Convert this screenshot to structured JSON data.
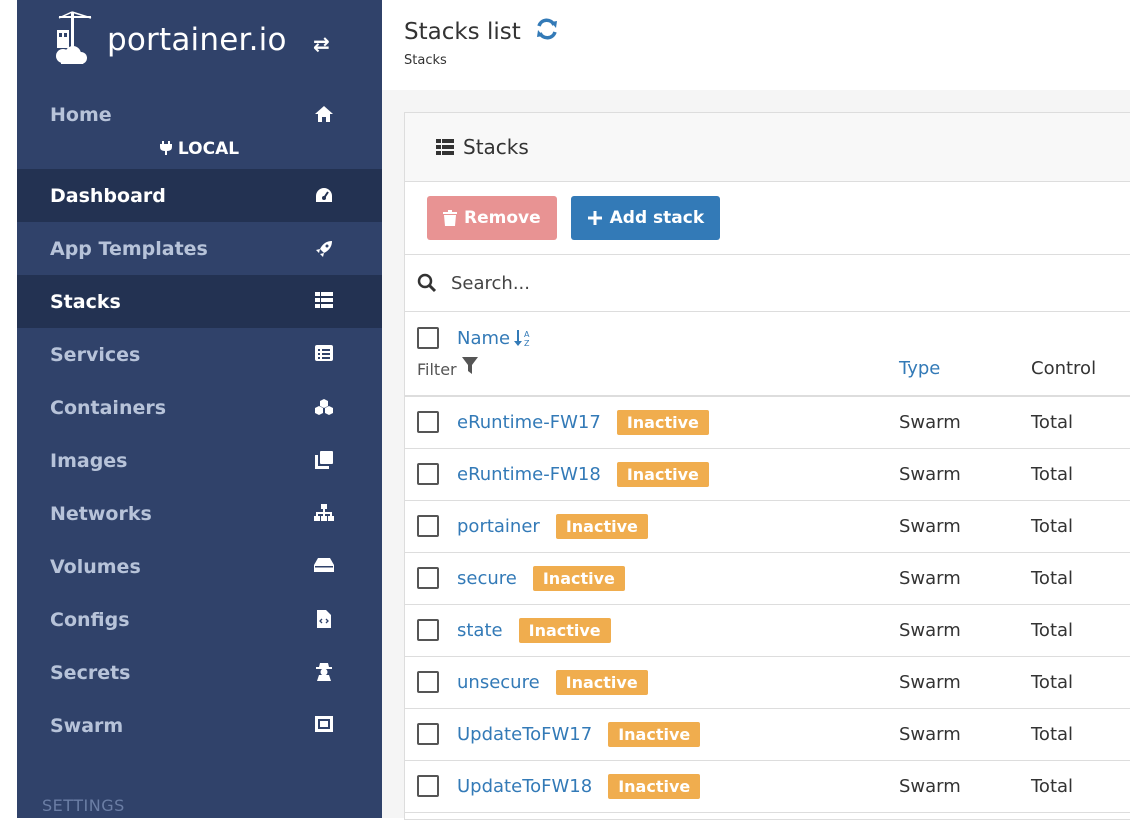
{
  "brand": {
    "name": "portainer.io"
  },
  "sidebar": {
    "home": "Home",
    "endpoint": "LOCAL",
    "items": [
      {
        "label": "Dashboard",
        "icon": "tachometer-icon"
      },
      {
        "label": "App Templates",
        "icon": "rocket-icon"
      },
      {
        "label": "Stacks",
        "icon": "th-list-icon"
      },
      {
        "label": "Services",
        "icon": "list-alt-icon"
      },
      {
        "label": "Containers",
        "icon": "cubes-icon"
      },
      {
        "label": "Images",
        "icon": "clone-icon"
      },
      {
        "label": "Networks",
        "icon": "sitemap-icon"
      },
      {
        "label": "Volumes",
        "icon": "hdd-icon"
      },
      {
        "label": "Configs",
        "icon": "file-code-icon"
      },
      {
        "label": "Secrets",
        "icon": "user-secret-icon"
      },
      {
        "label": "Swarm",
        "icon": "object-group-icon"
      }
    ],
    "settings_label": "SETTINGS"
  },
  "header": {
    "title": "Stacks list",
    "breadcrumb": "Stacks"
  },
  "panel": {
    "title": "Stacks",
    "remove_label": "Remove",
    "add_label": "Add stack",
    "search_placeholder": "Search...",
    "columns": {
      "name": "Name",
      "filter": "Filter",
      "type": "Type",
      "control": "Control"
    },
    "rows": [
      {
        "name": "eRuntime-FW17",
        "status": "Inactive",
        "type": "Swarm",
        "control": "Total"
      },
      {
        "name": "eRuntime-FW18",
        "status": "Inactive",
        "type": "Swarm",
        "control": "Total"
      },
      {
        "name": "portainer",
        "status": "Inactive",
        "type": "Swarm",
        "control": "Total"
      },
      {
        "name": "secure",
        "status": "Inactive",
        "type": "Swarm",
        "control": "Total"
      },
      {
        "name": "state",
        "status": "Inactive",
        "type": "Swarm",
        "control": "Total"
      },
      {
        "name": "unsecure",
        "status": "Inactive",
        "type": "Swarm",
        "control": "Total"
      },
      {
        "name": "UpdateToFW17",
        "status": "Inactive",
        "type": "Swarm",
        "control": "Total"
      },
      {
        "name": "UpdateToFW18",
        "status": "Inactive",
        "type": "Swarm",
        "control": "Total"
      }
    ]
  },
  "colors": {
    "sidebar": "#30426a",
    "sidebar_active": "#233252",
    "primary": "#337ab7",
    "danger_disabled": "#e89393",
    "warning": "#f0ad4e"
  }
}
